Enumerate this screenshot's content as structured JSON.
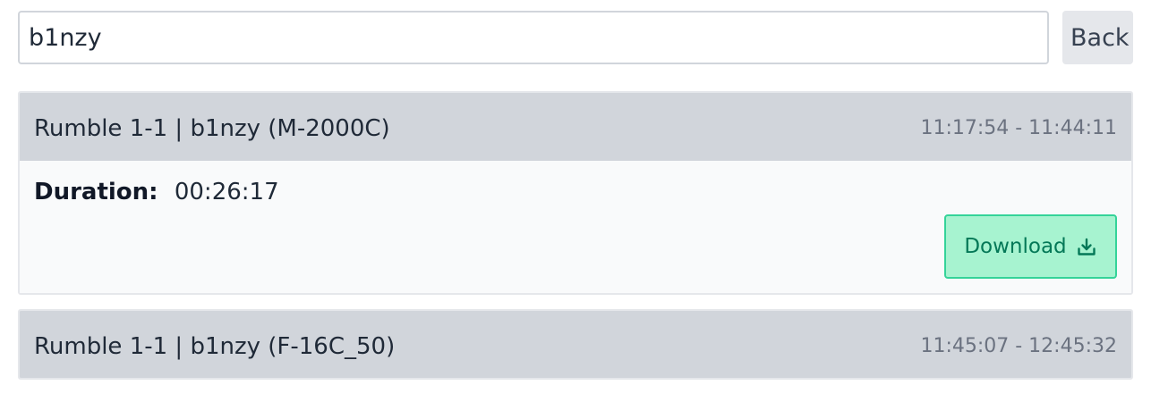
{
  "search": {
    "value": "b1nzy",
    "back_label": "Back"
  },
  "recordings": [
    {
      "title": "Rumble 1-1 | b1nzy (M-2000C)",
      "time_range": "11:17:54 - 11:44:11",
      "expanded": true,
      "duration_label": "Duration:",
      "duration_value": "00:26:17",
      "download_label": "Download",
      "download_icon": "download-icon"
    },
    {
      "title": "Rumble 1-1 | b1nzy (F-16C_50)",
      "time_range": "11:45:07 - 12:45:32",
      "expanded": false
    }
  ],
  "colors": {
    "header_bg": "#d1d5db",
    "download_bg": "#a7f3d0",
    "download_border": "#34d399",
    "download_text": "#047857"
  }
}
